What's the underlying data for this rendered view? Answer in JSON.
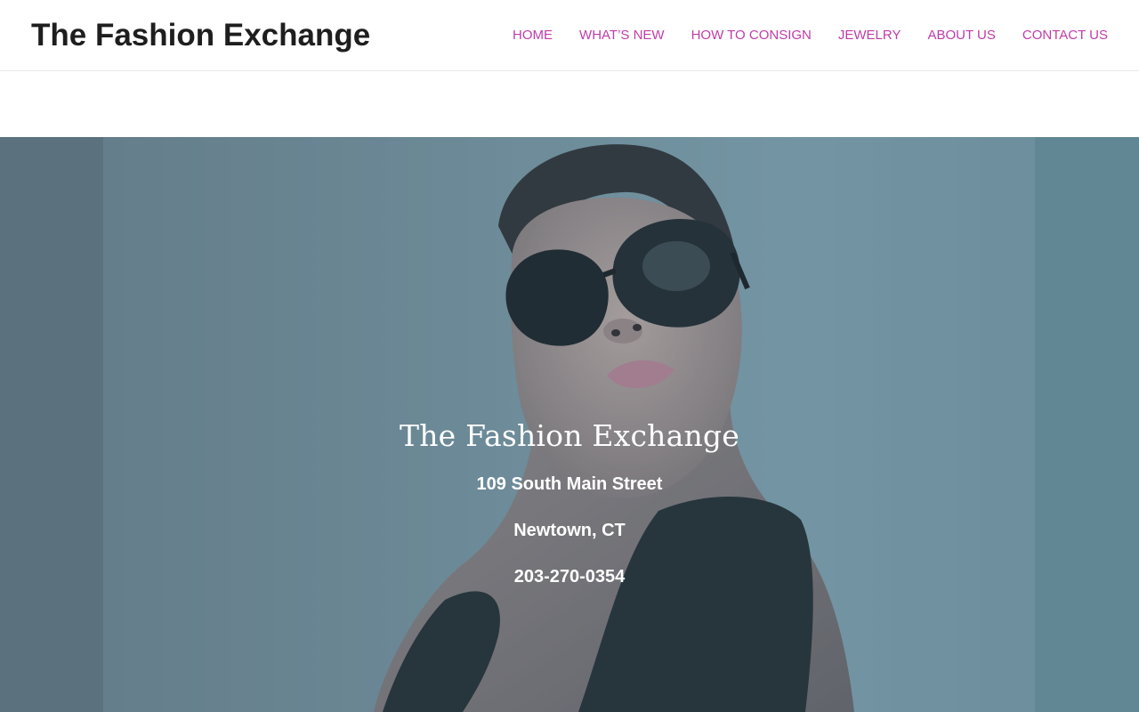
{
  "header": {
    "site_title": "The Fashion Exchange",
    "nav": [
      {
        "label": "HOME"
      },
      {
        "label": "WHAT’S NEW"
      },
      {
        "label": "HOW TO CONSIGN"
      },
      {
        "label": "JEWELRY"
      },
      {
        "label": "ABOUT US"
      },
      {
        "label": "CONTACT US"
      }
    ]
  },
  "hero": {
    "title": "The Fashion Exchange",
    "address": "109 South Main Street",
    "city": "Newtown, CT",
    "phone": "203-270-0354"
  },
  "colors": {
    "nav_link": "#c03ca8",
    "title_text": "#1e1e1e",
    "hero_text": "#ffffff",
    "hero_background": "#6e8c99"
  }
}
